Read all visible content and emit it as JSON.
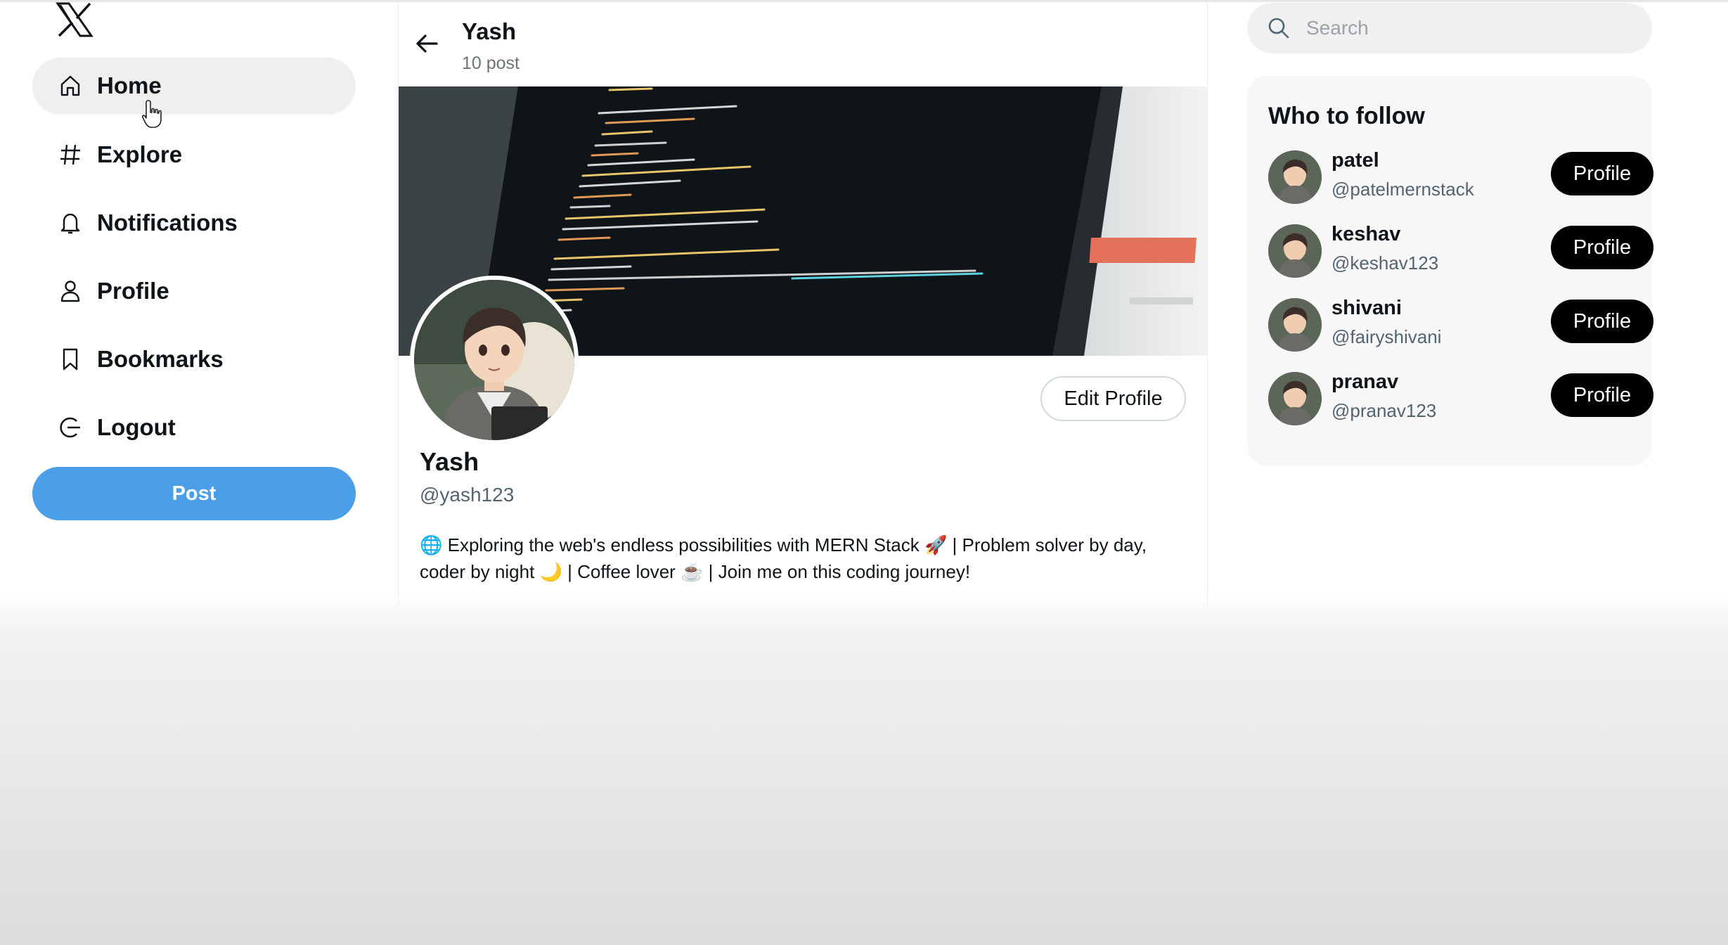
{
  "app": {
    "logo_icon": "x-logo-icon"
  },
  "sidebar": {
    "items": [
      {
        "label": "Home",
        "icon": "home-icon",
        "active": true
      },
      {
        "label": "Explore",
        "icon": "hash-icon"
      },
      {
        "label": "Notifications",
        "icon": "bell-icon"
      },
      {
        "label": "Profile",
        "icon": "user-icon"
      },
      {
        "label": "Bookmarks",
        "icon": "bookmark-icon"
      },
      {
        "label": "Logout",
        "icon": "logout-icon"
      }
    ],
    "post_label": "Post"
  },
  "header": {
    "name": "Yash",
    "post_count": "10 post"
  },
  "profile": {
    "name": "Yash",
    "handle": "@yash123",
    "edit_label": "Edit Profile",
    "bio_line1": "🌐 Exploring the web's endless possibilities with MERN Stack 🚀 | Problem solver by day,",
    "bio_line2": "coder by night 🌙 | Coffee lover ☕ | Join me on this coding journey!"
  },
  "search": {
    "placeholder": "Search"
  },
  "who_to_follow": {
    "title": "Who to follow",
    "users": [
      {
        "name": "patel",
        "handle": "@patelmernstack",
        "button": "Profile"
      },
      {
        "name": "keshav",
        "handle": "@keshav123",
        "button": "Profile"
      },
      {
        "name": "shivani",
        "handle": "@fairyshivani",
        "button": "Profile"
      },
      {
        "name": "pranav",
        "handle": "@pranav123",
        "button": "Profile"
      }
    ]
  },
  "colors": {
    "accent": "#4a9fe8",
    "active_bg": "#efefef",
    "button_dark": "#000000"
  }
}
